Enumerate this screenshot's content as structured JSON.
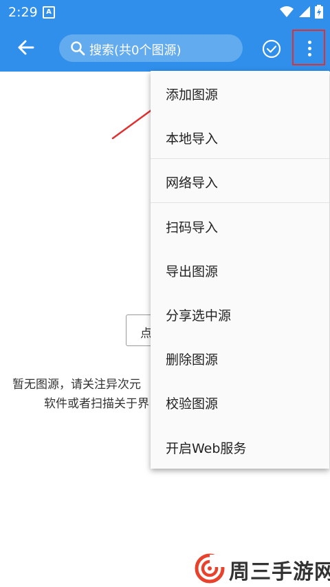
{
  "status_bar": {
    "time": "2:29",
    "app_icon_letter": "A"
  },
  "toolbar": {
    "search_placeholder": "搜索(共0个图源)",
    "highlight_color": "#e03030",
    "accent_color": "#2f8fea"
  },
  "content": {
    "import_button_label": "点",
    "empty_message_line1": "暂无图源，请关注异次元",
    "empty_message_line2": "软件或者扫描关于界"
  },
  "menu": {
    "items": [
      "添加图源",
      "本地导入",
      "网络导入",
      "扫码导入",
      "导出图源",
      "分享选中源",
      "删除图源",
      "校验图源",
      "开启Web服务"
    ]
  },
  "watermark": {
    "text": "周三手游网"
  }
}
